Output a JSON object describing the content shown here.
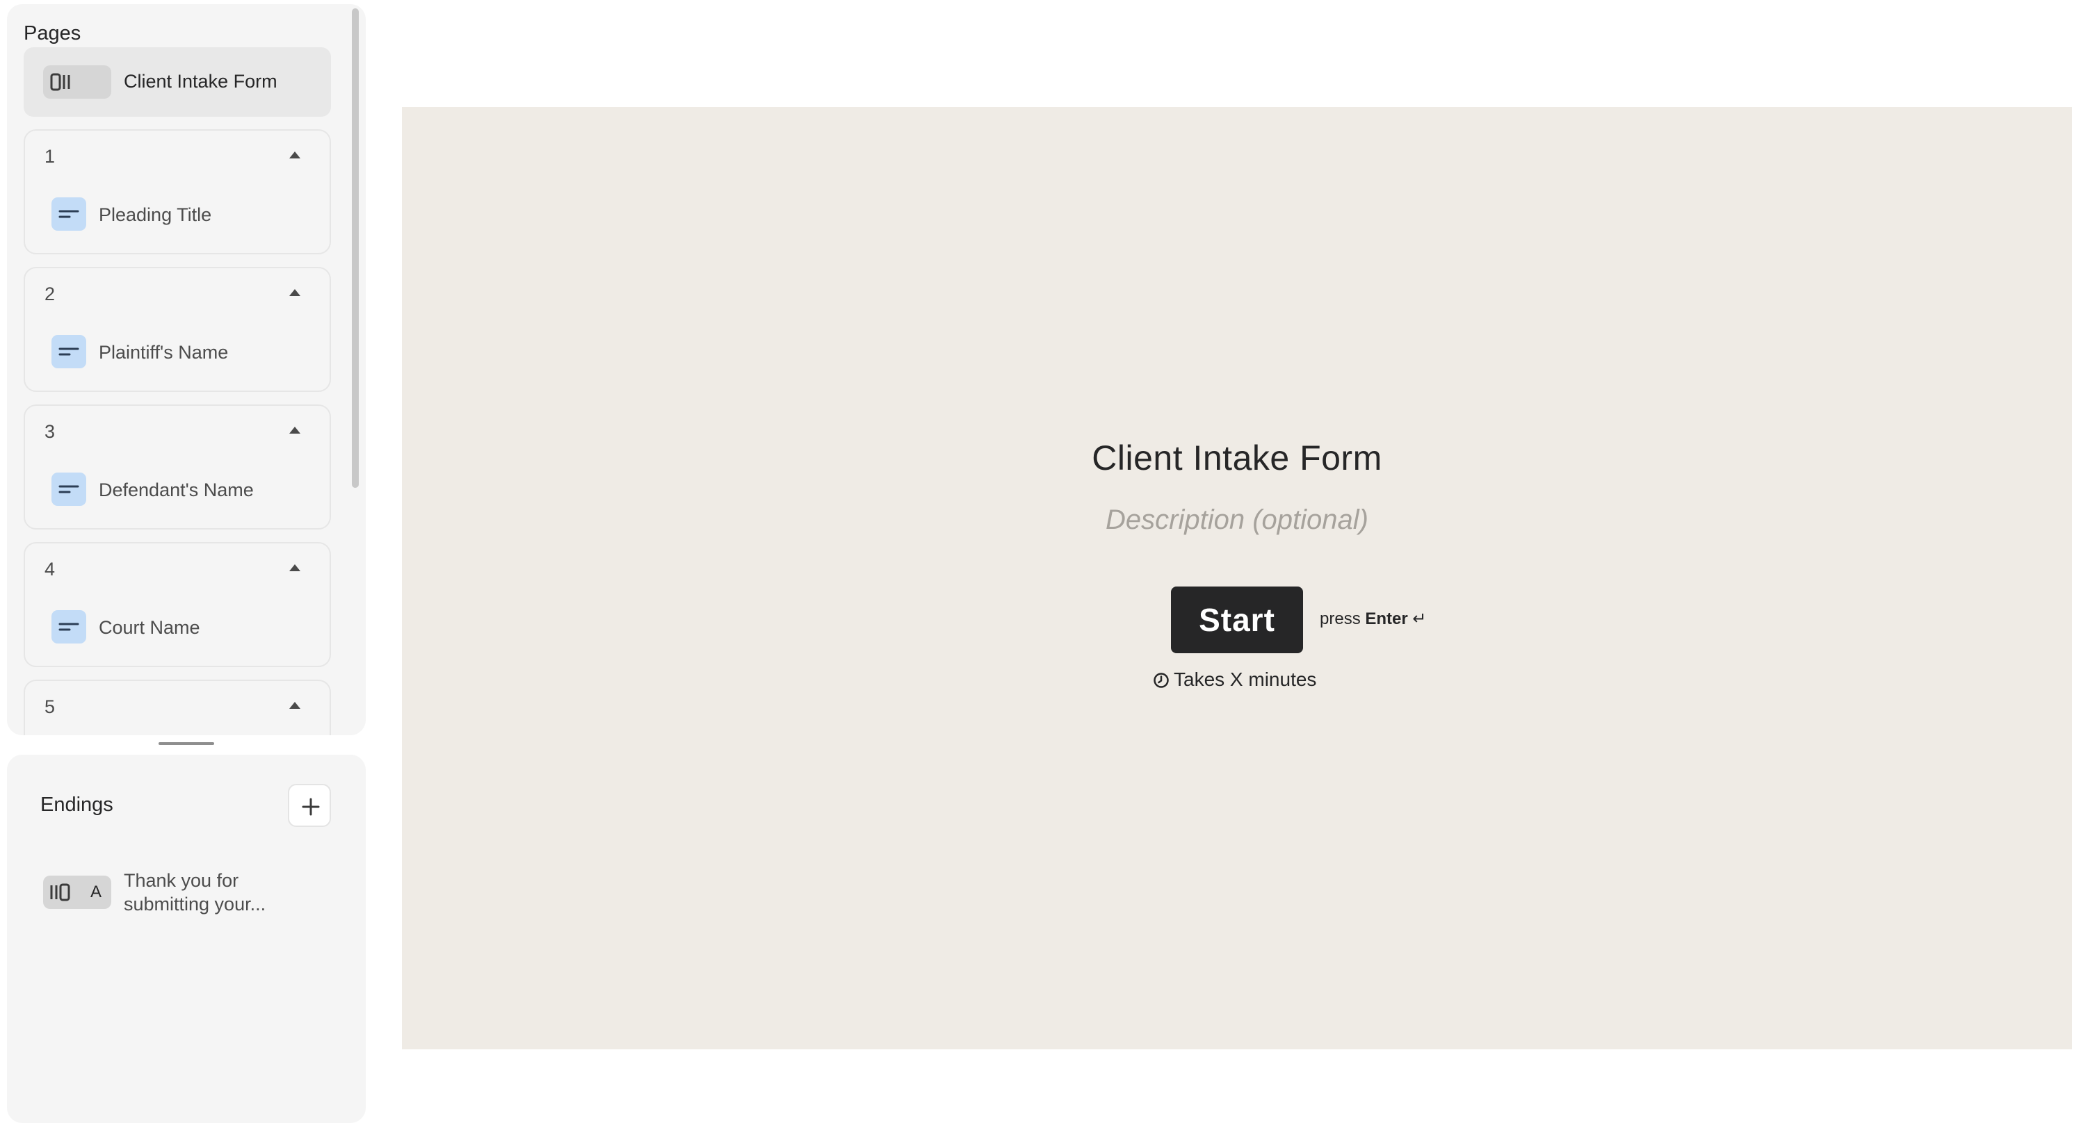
{
  "pages_panel": {
    "heading": "Pages",
    "welcome": {
      "label": "Client Intake Form",
      "icon": "welcome-screen-icon"
    },
    "questions": [
      {
        "number": "1",
        "label": "Pleading Title",
        "icon": "short-text-icon"
      },
      {
        "number": "2",
        "label": "Plaintiff's Name",
        "icon": "short-text-icon"
      },
      {
        "number": "3",
        "label": "Defendant's Name",
        "icon": "short-text-icon"
      },
      {
        "number": "4",
        "label": "Court Name",
        "icon": "short-text-icon"
      },
      {
        "number": "5",
        "label": "",
        "icon": "short-text-icon"
      }
    ]
  },
  "endings_panel": {
    "heading": "Endings",
    "add_icon": "plus-icon",
    "items": [
      {
        "letter": "A",
        "label": "Thank you for submitting your...",
        "icon": "ending-screen-icon"
      }
    ]
  },
  "preview": {
    "title": "Client Intake Form",
    "description_placeholder": "Description (optional)",
    "start_label": "Start",
    "press_prefix": "press",
    "press_key": "Enter",
    "press_glyph": "↵",
    "time_note": "Takes X minutes",
    "time_icon": "clock-icon"
  },
  "colors": {
    "canvas_background": "#efebe5",
    "sidebar_background": "#f5f5f5",
    "question_icon_background": "#c3dcf7",
    "start_button": "#262627",
    "text_primary": "#262627",
    "description_text": "#a6a29c"
  }
}
